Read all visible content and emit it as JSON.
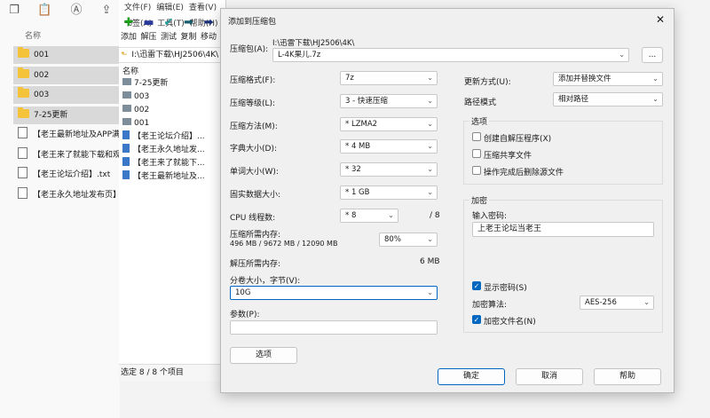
{
  "explorer": {
    "column_header": "名称",
    "items": [
      {
        "type": "folder",
        "name": "001",
        "selected": true
      },
      {
        "type": "folder",
        "name": "002",
        "selected": true
      },
      {
        "type": "folder",
        "name": "003",
        "selected": true
      },
      {
        "type": "folder",
        "name": "7-25更新",
        "selected": true
      },
      {
        "type": "file",
        "name": "【老王最新地址及APP满"
      },
      {
        "type": "file",
        "name": "【老王来了就能下载和观"
      },
      {
        "type": "file",
        "name": "【老王论坛介绍】.txt"
      },
      {
        "type": "file",
        "name": "【老王永久地址发布页】"
      }
    ]
  },
  "fm": {
    "menu": [
      "文件(F)",
      "编辑(E)",
      "查看(V)",
      "书签(A)",
      "工具(T)",
      "帮助(H)"
    ],
    "tools": [
      {
        "label": "添加",
        "glyph": "✚",
        "color": "#1ba31b"
      },
      {
        "label": "解压",
        "glyph": "▬",
        "color": "#2a3a9a"
      },
      {
        "label": "测试",
        "glyph": "✔",
        "color": "#1e9c9c"
      },
      {
        "label": "复制",
        "glyph": "➡",
        "color": "#155c6e"
      },
      {
        "label": "移动",
        "glyph": "➡",
        "color": "#1b2f7a"
      }
    ],
    "path": "I:\\迅雷下载\\HJ2506\\4K\\",
    "column_header": "名称",
    "items": [
      {
        "type": "folder",
        "name": "7-25更新"
      },
      {
        "type": "folder",
        "name": "003"
      },
      {
        "type": "folder",
        "name": "002"
      },
      {
        "type": "folder",
        "name": "001"
      },
      {
        "type": "file",
        "name": "【老王论坛介绍】..."
      },
      {
        "type": "file",
        "name": "【老王永久地址发..."
      },
      {
        "type": "file",
        "name": "【老王来了就能下..."
      },
      {
        "type": "file",
        "name": "【老王最新地址及..."
      }
    ],
    "status": "选定 8 / 8 个项目"
  },
  "dialog": {
    "title": "添加到压缩包",
    "archive_label": "压缩包(A):",
    "archive_dir": "I:\\迅雷下载\\HJ2506\\4K\\",
    "archive_name": "L-4K果儿.7z",
    "browse": "...",
    "format_label": "压缩格式(F):",
    "format_value": "7z",
    "level_label": "压缩等级(L):",
    "level_value": "3 - 快速压缩",
    "method_label": "压缩方法(M):",
    "method_value": "* LZMA2",
    "dict_label": "字典大小(D):",
    "dict_value": "* 4 MB",
    "word_label": "单词大小(W):",
    "word_value": "* 32",
    "solid_label": "固实数据大小:",
    "solid_value": "* 1 GB",
    "threads_label": "CPU 线程数:",
    "threads_value": "* 8",
    "threads_total": "/ 8",
    "mem_comp_label": "压缩所需内存:",
    "mem_comp_detail": "496 MB / 9672 MB / 12090 MB",
    "mem_percent": "80%",
    "mem_decomp_label": "解压所需内存:",
    "mem_decomp_value": "6 MB",
    "volume_label": "分卷大小，字节(V):",
    "volume_value": "10G",
    "params_label": "参数(P):",
    "params_value": "",
    "options_button": "选项",
    "update_label": "更新方式(U):",
    "update_value": "添加并替换文件",
    "pathmode_label": "路径模式",
    "pathmode_value": "相对路径",
    "options_group": "选项",
    "opt_sfx": "创建自解压程序(X)",
    "opt_shared": "压缩共享文件",
    "opt_delete": "操作完成后删除源文件",
    "encrypt_group": "加密",
    "password_label": "输入密码:",
    "password_value": "上老王论坛当老王",
    "show_password": "显示密码(S)",
    "enc_method_label": "加密算法:",
    "enc_method_value": "AES-256",
    "encrypt_names": "加密文件名(N)",
    "ok": "确定",
    "cancel": "取消",
    "help": "帮助",
    "close": "✕"
  },
  "colors": {
    "accent": "#0067c0",
    "folder": "#f5c33a",
    "selection": "#d9d9d9"
  }
}
